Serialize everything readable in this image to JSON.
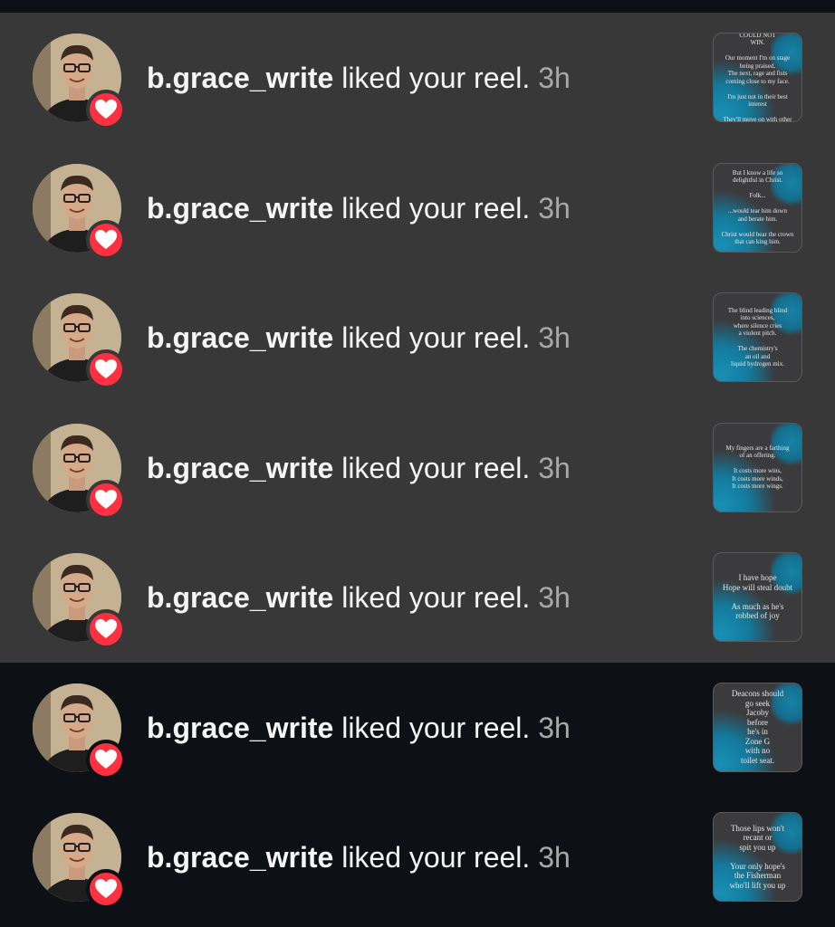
{
  "notifications": [
    {
      "username": "b.grace_write",
      "action": "liked your reel.",
      "time": "3h",
      "highlighted": true,
      "thumb_text": "COULD NOT\nWIN.\n\nOur moment I'm on stage\nbeing praised,\nThe next, rage and fists\ncoming close to my face.\n\nI'm just not in their best\ninterest\n\nThey'll move on with other",
      "thumb_size": "small"
    },
    {
      "username": "b.grace_write",
      "action": "liked your reel.",
      "time": "3h",
      "highlighted": true,
      "thumb_text": "But I know a life so\ndelightful in Christ.\n\nFolk...\n\n...would tear him down\nand berate him.\n\nChrist would bear the crown\nthat can king him.",
      "thumb_size": "small"
    },
    {
      "username": "b.grace_write",
      "action": "liked your reel.",
      "time": "3h",
      "highlighted": true,
      "thumb_text": "The blind leading blind\ninto sciences,\nwhere silence cries\na violent pitch.\n\nThe chemistry's\nan oil and\nliquid hydrogen mix.",
      "thumb_size": "small"
    },
    {
      "username": "b.grace_write",
      "action": "liked your reel.",
      "time": "3h",
      "highlighted": true,
      "thumb_text": "My fingers are a farthing\nof an offering.\n\nIt costs more wins,\nIt costs more winds,\nIt costs more wings.",
      "thumb_size": "small"
    },
    {
      "username": "b.grace_write",
      "action": "liked your reel.",
      "time": "3h",
      "highlighted": true,
      "thumb_text": "I have hope\nHope will steal doubt\n\nAs much as he's\nrobbed of joy",
      "thumb_size": "medium"
    },
    {
      "username": "b.grace_write",
      "action": "liked your reel.",
      "time": "3h",
      "highlighted": false,
      "thumb_text": "Deacons should\ngo seek\nJacoby\nbefore\nhe's in\nZone G\nwith no\ntoilet seat.",
      "thumb_size": "medium"
    },
    {
      "username": "b.grace_write",
      "action": "liked your reel.",
      "time": "3h",
      "highlighted": false,
      "thumb_text": "Those lips won't\nrecant or\nspit you up\n\nYour only hope's\nthe Fisherman\nwho'll lift you up",
      "thumb_size": "medium"
    }
  ],
  "icons": {
    "badge": "heart-icon"
  },
  "colors": {
    "highlight_bg": "#383838",
    "page_bg": "#0d1116",
    "badge": "#ff3040",
    "time": "#a8a8a8"
  }
}
